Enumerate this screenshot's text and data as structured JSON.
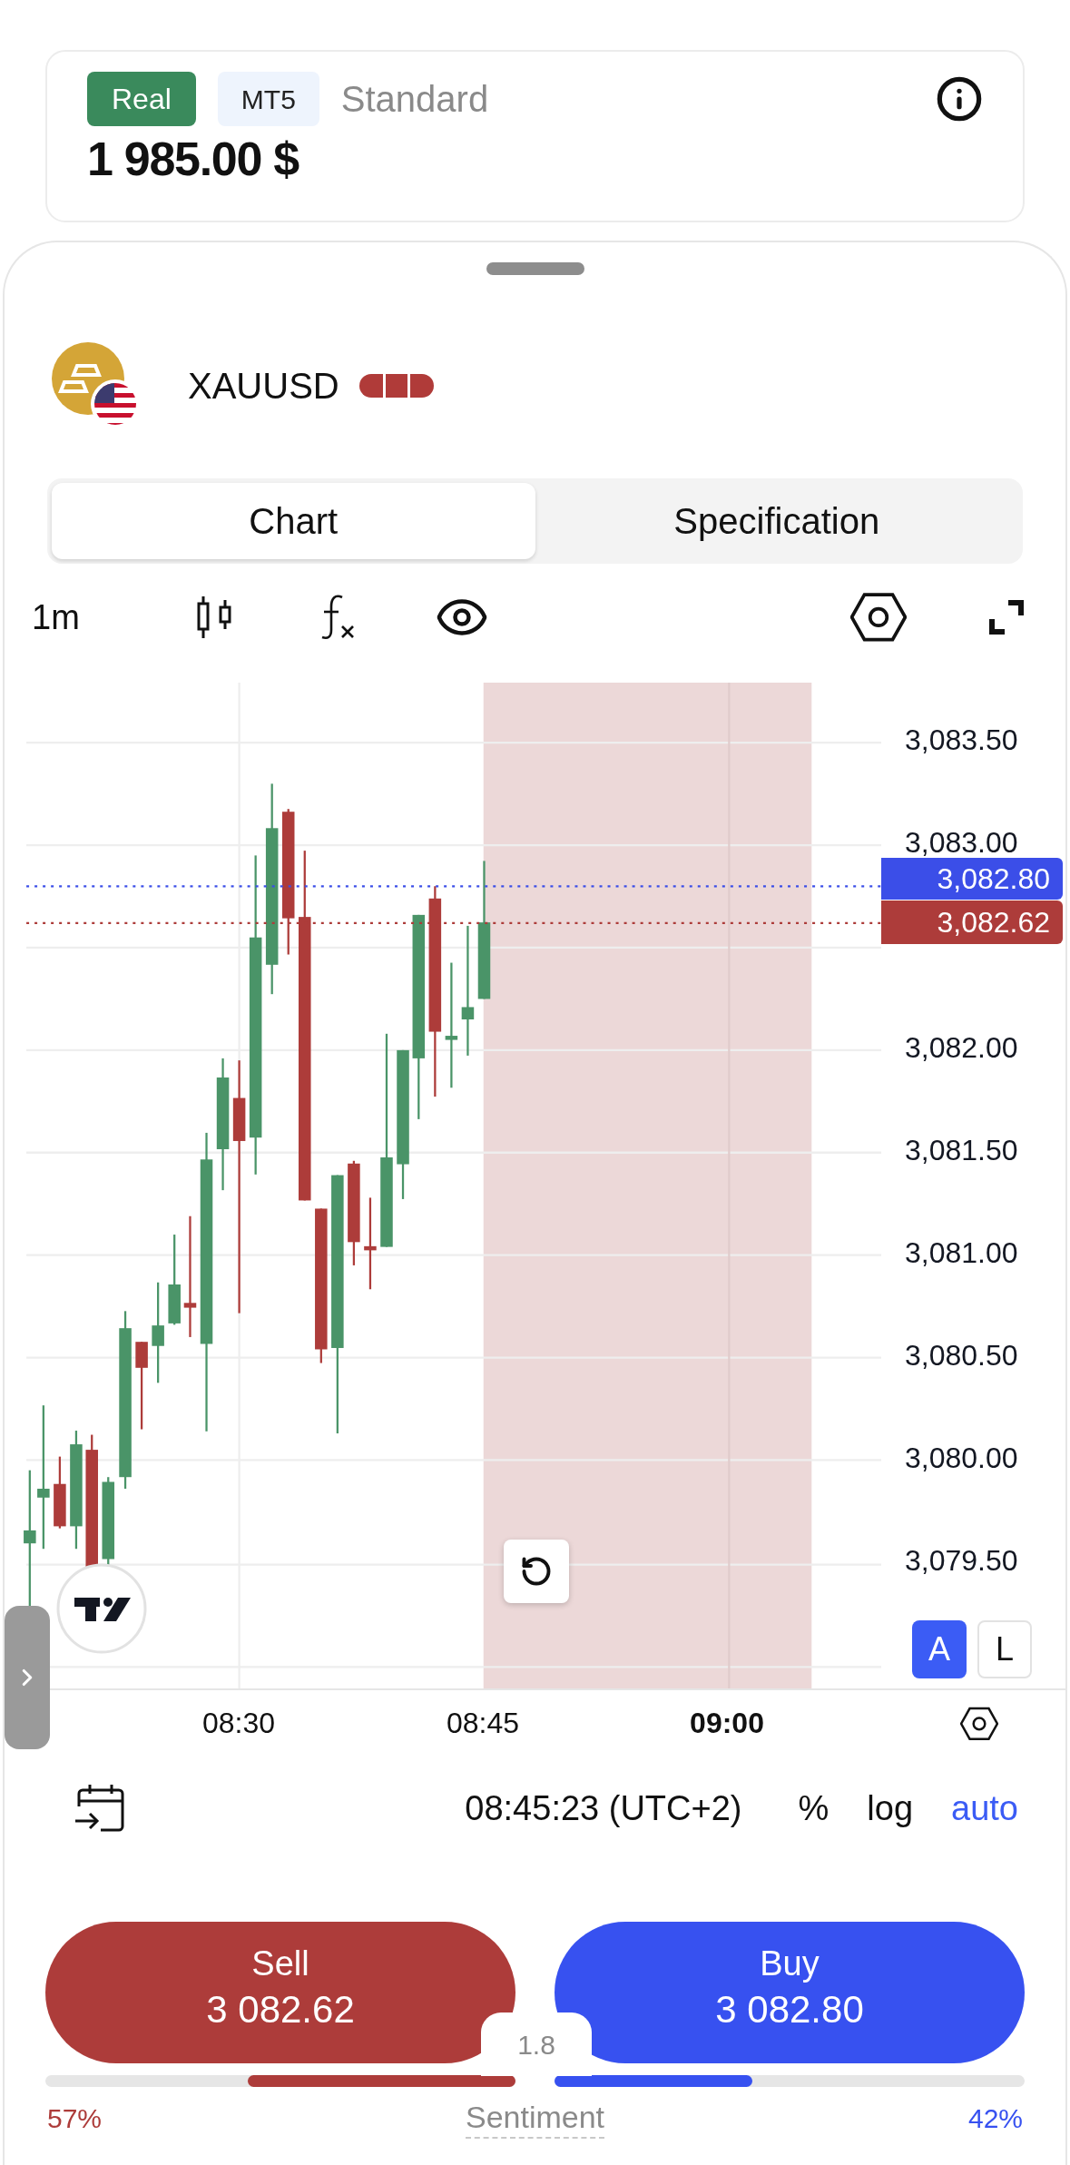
{
  "account": {
    "type_badge": "Real",
    "platform_badge": "MT5",
    "plan": "Standard",
    "balance": "1 985.00 $"
  },
  "instrument": {
    "symbol": "XAUUSD"
  },
  "tabs": [
    {
      "label": "Chart",
      "selected": true
    },
    {
      "label": "Specification",
      "selected": false
    }
  ],
  "toolbar": {
    "interval": "1m"
  },
  "chart": {
    "price_ticks_above": [
      "3,083.50",
      "3,083.00"
    ],
    "price_ticks_below": [
      "3,082.00",
      "3,081.50",
      "3,081.00",
      "3,080.50",
      "3,080.00",
      "3,079.50"
    ],
    "ask_badge": "3,082.80",
    "bid_badge": "3,082.62",
    "time_labels": [
      {
        "label": "08:30",
        "bold": false
      },
      {
        "label": "08:45",
        "bold": false
      },
      {
        "label": "09:00",
        "bold": true
      }
    ],
    "scale_buttons": [
      {
        "label": "A",
        "selected": true
      },
      {
        "label": "L",
        "selected": false
      }
    ]
  },
  "footer": {
    "clock": "08:45:23 (UTC+2)",
    "scale_options": [
      {
        "label": "%",
        "selected": false
      },
      {
        "label": "log",
        "selected": false
      },
      {
        "label": "auto",
        "selected": true
      }
    ]
  },
  "trade": {
    "sell": {
      "label": "Sell",
      "price": "3 082.62"
    },
    "buy": {
      "label": "Buy",
      "price": "3 082.80"
    },
    "spread": "1.8",
    "sentiment": {
      "label": "Sentiment",
      "sell_share": "57%",
      "buy_share": "42%",
      "sell_bar": {
        "level": 0.57
      },
      "buy_bar": {
        "level": 0.42
      }
    }
  }
}
